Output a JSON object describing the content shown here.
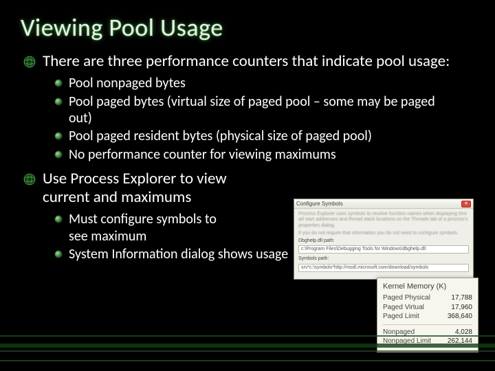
{
  "title": "Viewing Pool Usage",
  "bullets": {
    "a": {
      "text": "There are three performance counters that indicate pool usage:",
      "subs": [
        "Pool nonpaged bytes",
        "Pool paged bytes (virtual size of paged pool – some may be paged out)",
        "Pool paged resident bytes (physical size of paged pool)",
        "No performance counter for viewing maximums"
      ]
    },
    "b": {
      "text": "Use Process Explorer to view current and maximums",
      "subs": [
        "Must configure symbols to see maximum",
        "System Information dialog shows usage"
      ]
    }
  },
  "dialog": {
    "title": "Configure Symbols",
    "para1": "Process Explorer uses symbols to resolve function names when displaying thread start addresses and thread stack locations on the Threads tab of a process's properties dialog.",
    "para2": "If you do not require that information you do not need to configure symbols.",
    "label1": "Dbghelp.dll path:",
    "field1": "c:\\Program Files\\Debugging Tools for Windows\\dbghelp.dll",
    "label2": "Symbols path:",
    "field2": "srv*c:\\symbols*http://msdl.microsoft.com/download/symbols"
  },
  "panel": {
    "header": "Kernel Memory (K)",
    "rows1": [
      {
        "k": "Paged Physical",
        "v": "17,788"
      },
      {
        "k": "Paged Virtual",
        "v": "17,960"
      },
      {
        "k": "Paged Limit",
        "v": "368,640"
      }
    ],
    "rows2": [
      {
        "k": "Nonpaged",
        "v": "4,028"
      },
      {
        "k": "Nonpaged Limit",
        "v": "262,144"
      }
    ]
  }
}
